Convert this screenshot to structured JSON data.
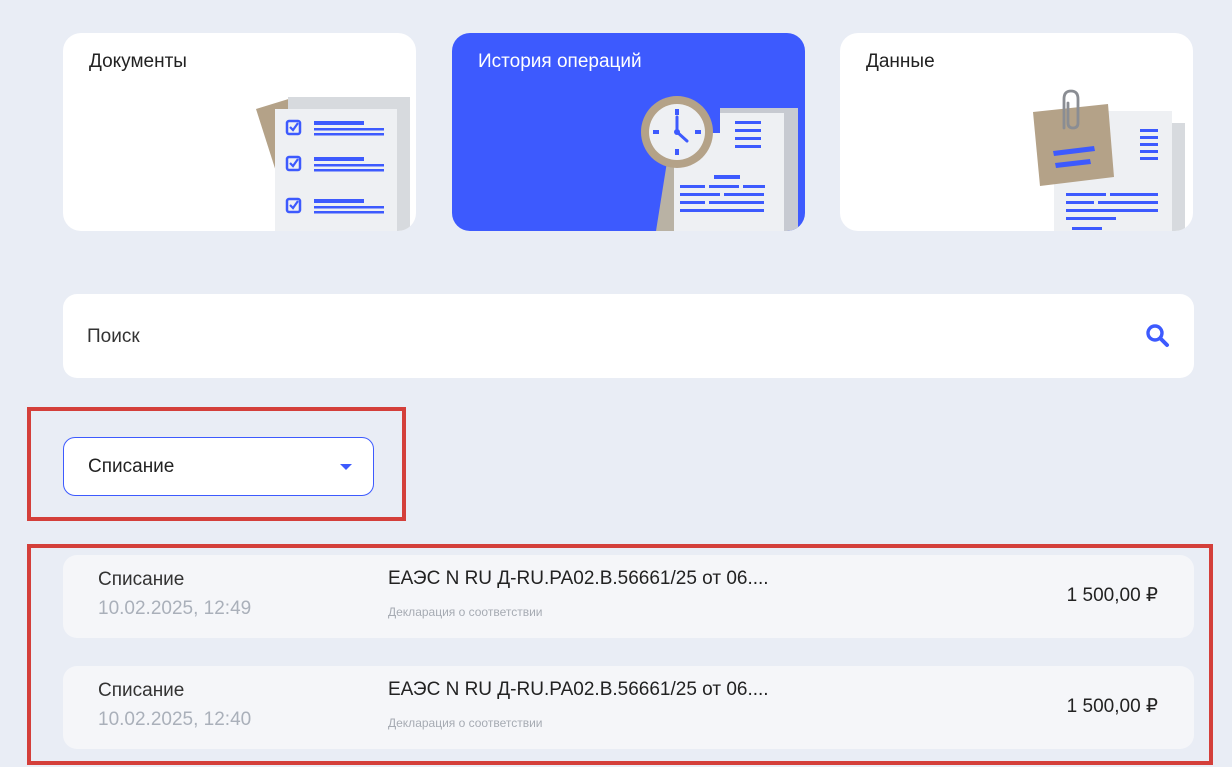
{
  "cards": [
    {
      "title": "Документы",
      "icon": "documents-checklist-icon"
    },
    {
      "title": "История операций",
      "icon": "operations-history-icon"
    },
    {
      "title": "Данные",
      "icon": "data-paperclip-icon"
    }
  ],
  "active_card": "История операций",
  "search": {
    "placeholder": "Поиск",
    "icon": "search-icon"
  },
  "filter": {
    "selected": "Списание",
    "icon": "caret-down-icon"
  },
  "operations": [
    {
      "type": "Списание",
      "datetime": "10.02.2025, 12:49",
      "document": "ЕАЭС N RU Д-RU.РА02.В.56661/25 от 06....",
      "subtitle": "Декларация о соответствии",
      "amount": "1 500,00 ₽"
    },
    {
      "type": "Списание",
      "datetime": "10.02.2025, 12:40",
      "document": "ЕАЭС N RU Д-RU.РА02.В.56661/25 от 06....",
      "subtitle": "Декларация о соответствии",
      "amount": "1 500,00 ₽"
    }
  ],
  "colors": {
    "accent": "#3d5afe",
    "background": "#e9edf5",
    "highlight": "#d43f3a"
  }
}
